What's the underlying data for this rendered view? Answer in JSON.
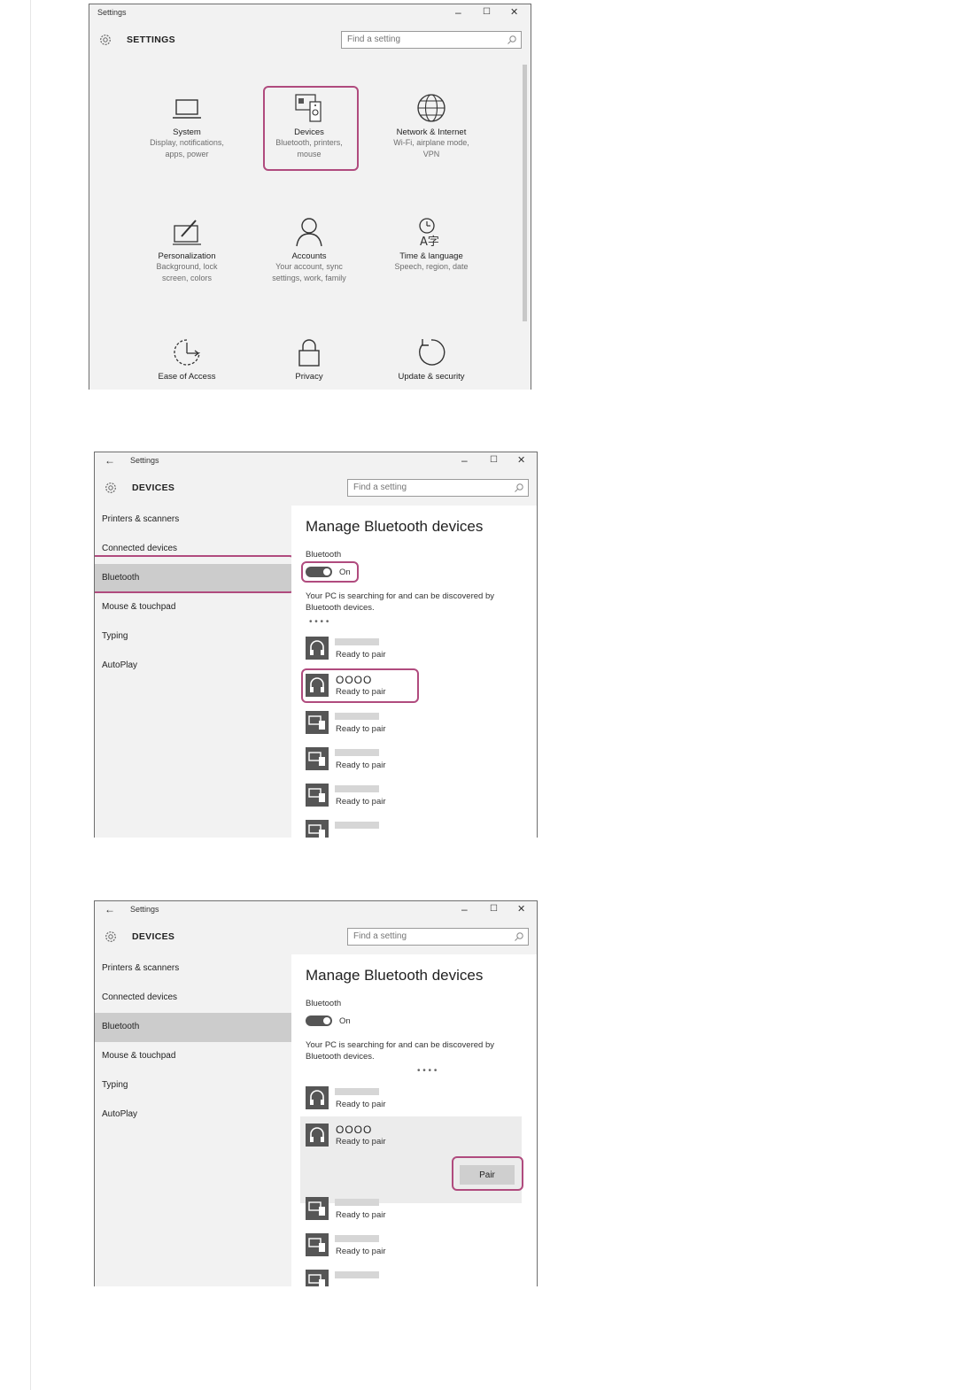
{
  "window1": {
    "title": "Settings",
    "header": "SETTINGS",
    "search_placeholder": "Find a setting",
    "controls": {
      "minimize": "–",
      "maximize": "☐",
      "close": "✕"
    },
    "tiles": [
      {
        "title": "System",
        "desc1": "Display, notifications,",
        "desc2": "apps, power",
        "desc3": ""
      },
      {
        "title": "Devices",
        "desc1": "Bluetooth, printers,",
        "desc2": "mouse",
        "desc3": ""
      },
      {
        "title": "Network & Internet",
        "desc1": "Wi-Fi, airplane mode,",
        "desc2": "VPN",
        "desc3": ""
      },
      {
        "title": "Personalization",
        "desc1": "Background, lock",
        "desc2": "screen, colors",
        "desc3": ""
      },
      {
        "title": "Accounts",
        "desc1": "Your account, sync",
        "desc2": "settings, work, family",
        "desc3": ""
      },
      {
        "title": "Time & language",
        "desc1": "Speech, region, date",
        "desc2": "",
        "desc3": ""
      },
      {
        "title": "Ease of Access",
        "desc1": "",
        "desc2": "",
        "desc3": ""
      },
      {
        "title": "Privacy",
        "desc1": "",
        "desc2": "",
        "desc3": ""
      },
      {
        "title": "Update & security",
        "desc1": "",
        "desc2": "",
        "desc3": ""
      }
    ]
  },
  "window2": {
    "title": "Settings",
    "back": "←",
    "header": "DEVICES",
    "search_placeholder": "Find a setting",
    "controls": {
      "minimize": "–",
      "maximize": "☐",
      "close": "✕"
    },
    "nav": [
      "Printers & scanners",
      "Connected devices",
      "Bluetooth",
      "Mouse & touchpad",
      "Typing",
      "AutoPlay"
    ],
    "heading": "Manage Bluetooth devices",
    "bt_label": "Bluetooth",
    "toggle_state": "On",
    "description": "Your PC is searching for and can be discovered by Bluetooth devices.",
    "dots": "•     •     •     •",
    "device_name": "OOOO",
    "status": "Ready to pair"
  },
  "window3": {
    "title": "Settings",
    "back": "←",
    "header": "DEVICES",
    "search_placeholder": "Find a setting",
    "controls": {
      "minimize": "–",
      "maximize": "☐",
      "close": "✕"
    },
    "nav": [
      "Printers & scanners",
      "Connected devices",
      "Bluetooth",
      "Mouse & touchpad",
      "Typing",
      "AutoPlay"
    ],
    "heading": "Manage Bluetooth devices",
    "bt_label": "Bluetooth",
    "toggle_state": "On",
    "description": "Your PC is searching for and can be discovered by Bluetooth devices.",
    "dots": "•     •     •     •",
    "device_name": "OOOO",
    "status": "Ready to pair",
    "pair_label": "Pair"
  },
  "icons": [
    "gear-icon",
    "search-icon",
    "laptop-icon",
    "devices-icon",
    "globe-icon",
    "personalization-icon",
    "person-icon",
    "time-language-icon",
    "ease-of-access-icon",
    "lock-icon",
    "refresh-icon",
    "headphones-icon",
    "device-monitor-icon"
  ],
  "colors": {
    "highlight": "#b04b7e",
    "window_bg": "#f2f2f2",
    "selected_nav": "#cccccc",
    "toggle": "#555555"
  }
}
